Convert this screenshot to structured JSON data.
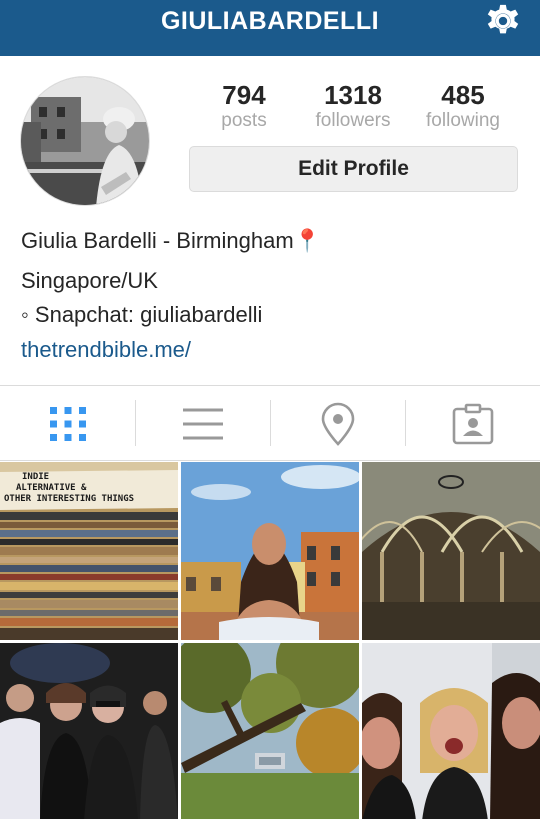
{
  "header": {
    "username": "GIULIABARDELLI",
    "settings_icon": "gear-icon"
  },
  "profile": {
    "stats": [
      {
        "value": "794",
        "label": "posts"
      },
      {
        "value": "1318",
        "label": "followers"
      },
      {
        "value": "485",
        "label": "following"
      }
    ],
    "edit_button_label": "Edit Profile",
    "name_line": "Giulia Bardelli - Birmingham📍",
    "location": "Singapore/UK",
    "snapchat": "◦ Snapchat: giuliabardelli",
    "website": "thetrendbible.me/"
  },
  "tabs": [
    {
      "name": "grid-view",
      "icon": "grid-icon",
      "active": true
    },
    {
      "name": "list-view",
      "icon": "list-icon",
      "active": false
    },
    {
      "name": "places",
      "icon": "location-pin-icon",
      "active": false
    },
    {
      "name": "tagged",
      "icon": "tagged-person-icon",
      "active": false
    }
  ],
  "posts": {
    "post1_label_lines": [
      "INDIE",
      "ALTERNATIVE &",
      "OTHER INTERESTING THINGS"
    ]
  },
  "colors": {
    "header_bg": "#1b5a8c",
    "accent_blue": "#3897f0",
    "link": "#1b5a8c"
  }
}
